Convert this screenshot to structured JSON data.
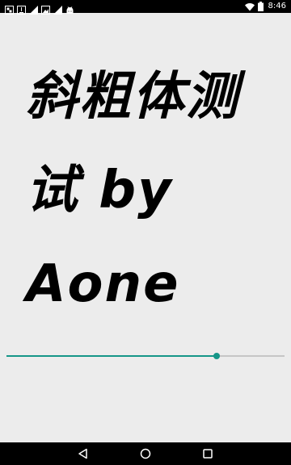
{
  "status_bar": {
    "time": "8:46",
    "left_icons": [
      "gallery-icon",
      "download-icon",
      "signal-icon",
      "image-icon",
      "signal-icon",
      "android-icon"
    ],
    "right_icons": [
      "wifi-icon",
      "battery-icon"
    ]
  },
  "main": {
    "italic_text": "斜粗体测试 by Aone"
  },
  "seekbar": {
    "progress": 0.755,
    "accent_color": "#159688",
    "track_color": "#c6c6c6"
  },
  "nav_bar": {
    "buttons": [
      "back-icon",
      "home-icon",
      "recents-icon"
    ]
  }
}
